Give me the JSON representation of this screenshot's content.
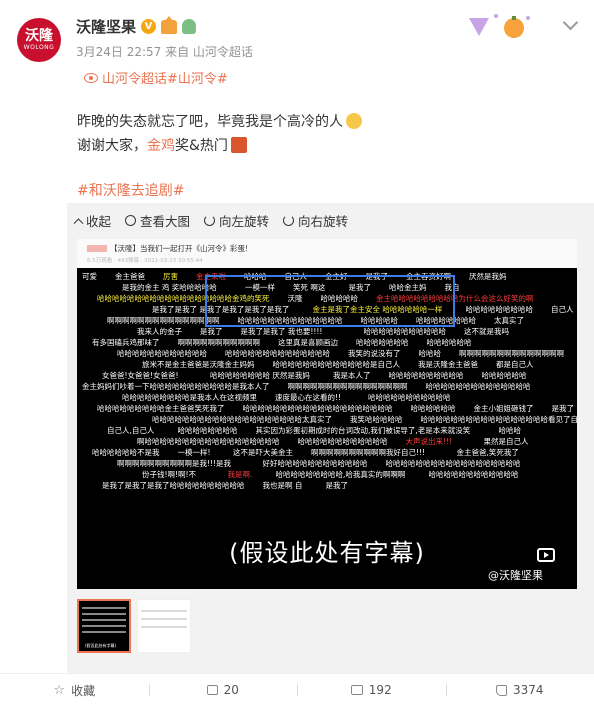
{
  "post": {
    "avatar_text": "沃隆",
    "avatar_sub": "WOLONG",
    "name": "沃隆坚果",
    "verified_mark": "V",
    "meta": "3月24日 22:57  来自 山河令超话",
    "topic": "山河令超话#山河令#",
    "line1": "昨晚的失态就忘了吧，毕竟我是个高冷的人",
    "line2_pre": "谢谢大家，",
    "line2_hl": "金鸡",
    "line2_post": "奖&热门",
    "hashtag": "#和沃隆去追剧#"
  },
  "toolbar": {
    "collapse": "收起",
    "view_large": "查看大图",
    "rotate_left": "向左旋转",
    "rotate_right": "向右旋转"
  },
  "image": {
    "title_tag": "【沃隆】",
    "title_text": "当我们一起打开《山河令》彩蛋!",
    "timestamp": "6.5万观看 · 493弹幕 · 2021-03-23 20:55:44",
    "subtitle": "(假设此处有字幕)",
    "watermark": "@沃隆坚果",
    "danmaku": [
      {
        "t": "可爱",
        "c": ""
      },
      {
        "t": "金主爸爸",
        "c": ""
      },
      {
        "t": "厉害",
        "c": "y"
      },
      {
        "t": "金主来啦",
        "c": "r"
      },
      {
        "t": "哈哈哈",
        "c": ""
      },
      {
        "t": "自己人",
        "c": ""
      },
      {
        "t": "金主好",
        "c": ""
      },
      {
        "t": "是我了",
        "c": ""
      },
      {
        "t": "金主吞资好啊",
        "c": ""
      },
      {
        "t": "厌然是我妈",
        "c": ""
      },
      {
        "t": "是我的金主 鸡 奖哈哈哈哈哈",
        "c": ""
      },
      {
        "t": "一模一样",
        "c": ""
      },
      {
        "t": "笑死 啊这",
        "c": ""
      },
      {
        "t": "是我了",
        "c": ""
      },
      {
        "t": "哈哈金主妈",
        "c": ""
      },
      {
        "t": "我自",
        "c": ""
      },
      {
        "t": "哈哈哈哈哈哈哈哈哈哈哈哈哈哈哈哈哈哈金鸡的笑死",
        "c": "y"
      },
      {
        "t": "沃隆",
        "c": ""
      },
      {
        "t": "哈哈哈哈哈",
        "c": ""
      },
      {
        "t": "金主哈哈哈哈哈哈哈哈哈为什么会这么好笑的啊",
        "c": "r"
      },
      {
        "t": "是我了是我了 是我了是我了是我了是我了",
        "c": ""
      },
      {
        "t": "金主是我了金主安全 哈哈哈哈哈哈一样",
        "c": "y"
      },
      {
        "t": "哈哈哈哈哈哈哈哈哈",
        "c": ""
      },
      {
        "t": "自己人",
        "c": ""
      },
      {
        "t": "啊啊啊啊啊啊啊啊啊啊啊啊啊啊啊",
        "c": ""
      },
      {
        "t": "哈哈哈哈哈哈哈哈哈哈哈哈哈哈",
        "c": ""
      },
      {
        "t": "哈哈哈哈哈",
        "c": ""
      },
      {
        "t": "哈哈哈哈哈哈哈哈",
        "c": ""
      },
      {
        "t": "太真实了",
        "c": ""
      },
      {
        "t": "我来人的金子",
        "c": ""
      },
      {
        "t": "是我了",
        "c": ""
      },
      {
        "t": "是我了是我了 我也要!!!!",
        "c": ""
      },
      {
        "t": "哈哈哈哈哈哈哈哈哈哈哈",
        "c": ""
      },
      {
        "t": "这不就是我吗",
        "c": ""
      },
      {
        "t": "有多国磕兵鸡那味了",
        "c": ""
      },
      {
        "t": "啊啊啊啊啊啊啊啊啊啊啊",
        "c": ""
      },
      {
        "t": "这里真是喜顾画边",
        "c": ""
      },
      {
        "t": "哈哈哈哈哈哈哈",
        "c": ""
      },
      {
        "t": "哈哈哈哈哈哈",
        "c": ""
      },
      {
        "t": "哈哈哈哈哈哈哈哈哈哈哈哈",
        "c": ""
      },
      {
        "t": "哈哈哈哈哈哈哈哈哈哈哈哈哈哈",
        "c": ""
      },
      {
        "t": "我笑的说没有了",
        "c": ""
      },
      {
        "t": "哈哈哈",
        "c": ""
      },
      {
        "t": "啊啊啊啊啊啊啊啊啊啊啊啊啊啊",
        "c": ""
      },
      {
        "t": "旅米不是金主爸爸是沃隆金主妈妈",
        "c": ""
      },
      {
        "t": "哈哈哈哈哈哈哈哈哈哈哈哈哈是自己人",
        "c": ""
      },
      {
        "t": "我是沃隆金主爸爸",
        "c": ""
      },
      {
        "t": "都是自己人",
        "c": ""
      },
      {
        "t": "女爸爸!女爸爸!女爸爸!",
        "c": ""
      },
      {
        "t": "哈哈哈哈哈哈哈哈 厌然是我妈",
        "c": ""
      },
      {
        "t": "我是本人了",
        "c": ""
      },
      {
        "t": "哈哈哈哈哈哈哈哈哈哈",
        "c": ""
      },
      {
        "t": "哈哈哈哈哈哈",
        "c": ""
      },
      {
        "t": "金主妈妈们吵着一下哈哈哈哈哈哈哈哈哈哈哈是我本人了",
        "c": ""
      },
      {
        "t": "啊啊啊啊啊啊啊啊啊啊啊啊啊啊啊啊",
        "c": ""
      },
      {
        "t": "哈哈哈哈哈哈哈哈哈哈哈哈哈哈",
        "c": ""
      },
      {
        "t": "哈哈哈哈哈哈哈哈哈是我本人在这视频里",
        "c": ""
      },
      {
        "t": "速度最心在这看的!!",
        "c": ""
      },
      {
        "t": "哈哈哈哈哈哈哈哈哈哈哈",
        "c": ""
      },
      {
        "t": "哈哈哈哈哈哈哈哈哈金主爸爸笑死我了",
        "c": ""
      },
      {
        "t": "哈哈哈哈哈哈哈哈哈哈哈哈哈哈哈哈哈哈哈哈",
        "c": ""
      },
      {
        "t": "哈哈哈哈哈哈",
        "c": ""
      },
      {
        "t": "金主小姐姐砸钱了",
        "c": ""
      },
      {
        "t": "是我了",
        "c": ""
      },
      {
        "t": "哈哈哈哈哈哈哈哈哈哈哈哈哈哈哈哈哈哈哈哈太真实了",
        "c": ""
      },
      {
        "t": "我笑哈哈哈哈哈",
        "c": ""
      },
      {
        "t": "哈哈哈哈哈哈哈哈哈哈哈哈哈哈哈哈哈看见了自己",
        "c": ""
      },
      {
        "t": "自己人,自己人",
        "c": ""
      },
      {
        "t": "哈哈哈哈哈哈哈哈",
        "c": ""
      },
      {
        "t": "其实因为彩蛋初期成时的台词改动,我们被误导了,老是本来就没笑",
        "c": ""
      },
      {
        "t": "哈哈哈",
        "c": ""
      },
      {
        "t": "啊哈哈哈哈哈哈哈哈哈哈哈哈哈哈哈哈哈哈",
        "c": ""
      },
      {
        "t": "哈哈哈哈哈哈哈哈哈哈哈哈",
        "c": ""
      },
      {
        "t": "大声说出来!!!",
        "c": "r"
      },
      {
        "t": "果然是自己人",
        "c": ""
      },
      {
        "t": "哈哈哈哈哈哈不是我",
        "c": ""
      },
      {
        "t": "一模一样!",
        "c": ""
      },
      {
        "t": "这不是吓大美金主",
        "c": ""
      },
      {
        "t": "啊啊啊啊啊啊啊啊啊啊我好自己!!!",
        "c": ""
      },
      {
        "t": "金主爸爸,笑死我了",
        "c": ""
      },
      {
        "t": "啊啊啊啊啊啊啊啊啊啊是我!!!是我",
        "c": ""
      },
      {
        "t": "好好哈哈哈哈哈哈哈哈哈哈哈哈",
        "c": ""
      },
      {
        "t": "哈哈哈哈哈哈哈哈哈哈哈哈哈哈哈哈哈哈",
        "c": ""
      },
      {
        "t": "份子钱!啊!啊!不",
        "c": ""
      },
      {
        "t": "我是啊.",
        "c": "r"
      },
      {
        "t": "哈哈哈哈哈哈哈哈哈,哈我真实的啊啊啊",
        "c": ""
      },
      {
        "t": "哈哈哈哈哈哈哈哈哈哈哈哈",
        "c": ""
      },
      {
        "t": "是我了是我了是我了哈哈哈哈哈哈哈哈哈哈",
        "c": ""
      },
      {
        "t": "我也是啊 自",
        "c": ""
      },
      {
        "t": "是我了",
        "c": ""
      }
    ]
  },
  "footer": {
    "favorite": "收藏",
    "share_count": "20",
    "comment_count": "192",
    "like_count": "3374"
  },
  "colors": {
    "accent": "#eb7350",
    "avatar_red": "#c8102e",
    "verified": "#f7a616",
    "selection": "#3d7be8"
  }
}
